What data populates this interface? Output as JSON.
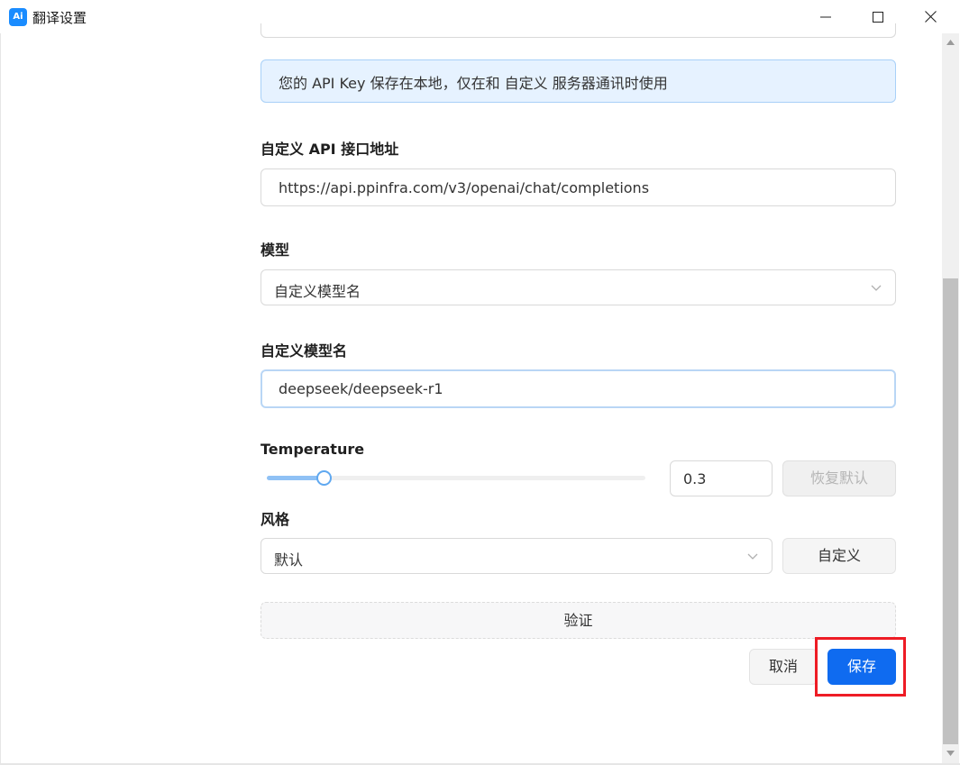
{
  "window": {
    "title": "翻译设置",
    "app_icon_text": "Ai",
    "controls": [
      "minimize",
      "maximize",
      "close"
    ]
  },
  "info": {
    "text": "您的 API Key 保存在本地，仅在和 自定义 服务器通讯时使用"
  },
  "api_endpoint": {
    "label": "自定义 API 接口地址",
    "value": "https://api.ppinfra.com/v3/openai/chat/completions"
  },
  "model": {
    "label": "模型",
    "selected": "自定义模型名"
  },
  "custom_model": {
    "label": "自定义模型名",
    "value": "deepseek/deepseek-r1"
  },
  "temperature": {
    "label": "Temperature",
    "value": "0.3",
    "slider_fraction": 0.15,
    "reset_label": "恢复默认"
  },
  "style": {
    "label": "风格",
    "selected": "默认",
    "custom_label": "自定义"
  },
  "actions": {
    "verify_label": "验证",
    "cancel_label": "取消",
    "save_label": "保存"
  },
  "colors": {
    "primary": "#0f6bf0",
    "info_bg": "#e6f2ff",
    "highlight": "#ee1c25"
  }
}
